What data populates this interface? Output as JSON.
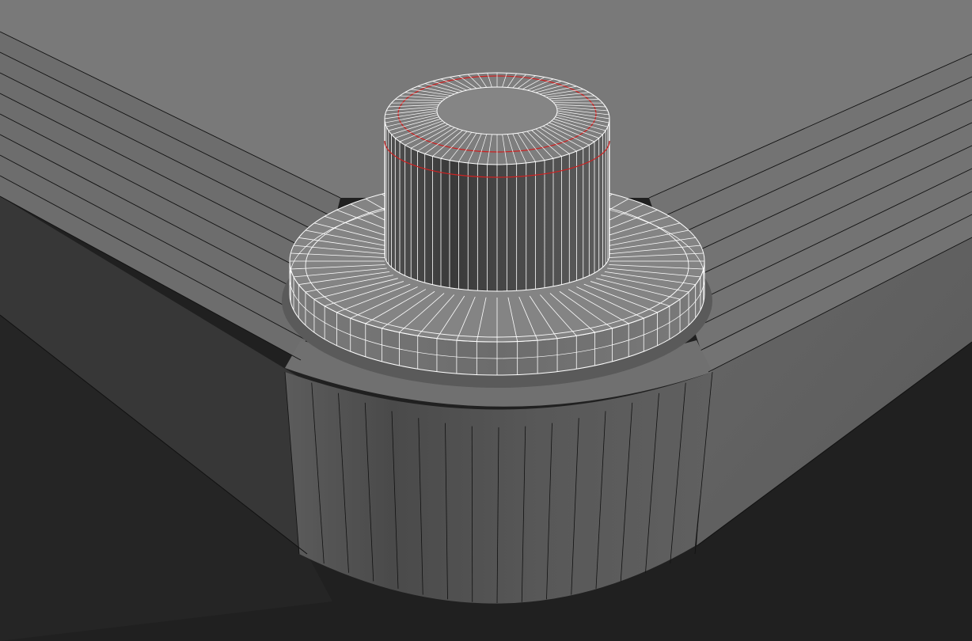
{
  "viewport": {
    "background_color": "#202020",
    "top_surface_color": "#777777",
    "bevel_color": "#6a6a6a",
    "side_wall_color": "#555555",
    "shadow_wall_color": "#3e3e3e",
    "mesh_edge_color": "#111111",
    "selected_wire_color": "#ffffff",
    "selected_edge_loop_color": "#cc2222",
    "cap_radial_segments": 72,
    "plate_radial_segments": 64,
    "shading": "smooth-shaded-with-wireframe"
  },
  "objects": [
    {
      "name": "table-top-slab",
      "selected": false
    },
    {
      "name": "cylinder-knob",
      "selected": true
    }
  ]
}
